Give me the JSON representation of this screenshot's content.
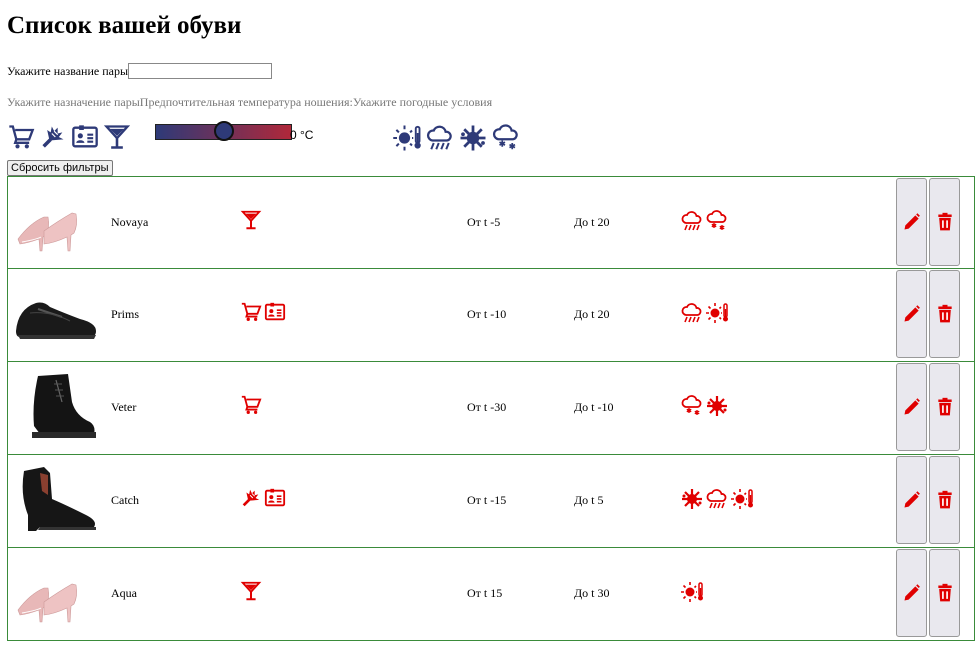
{
  "page": {
    "title": "Список вашей обуви"
  },
  "filters": {
    "name_label": "Укажите название пары",
    "name_value": "",
    "purpose_hint": "Укажите назначение пары",
    "temp_hint": "Предпочтительная температура ношения:",
    "weather_hint": "Укажите погодные условия",
    "purpose_icons": [
      "shopping-cart-icon",
      "sport-shuttlecock-icon",
      "id-card-icon",
      "cocktail-glass-icon"
    ],
    "temperature_value": "0 °C",
    "temperature_slider_fraction": 0.5,
    "weather_icons": [
      "sun-thermometer-icon",
      "rain-cloud-icon",
      "wind-splash-icon",
      "snow-cloud-icon"
    ],
    "reset_label": "Сбросить фильтры"
  },
  "colors": {
    "accent_red": "#e00000",
    "navy": "#2e3a78",
    "row_border": "#3a8b3a"
  },
  "shoes": [
    {
      "name": "Novaya",
      "from": "От t -5",
      "to": "До t 20",
      "image": "pink-pumps",
      "purpose": [
        "cocktail-glass-icon"
      ],
      "weather": [
        "rain-cloud-icon",
        "snow-cloud-icon"
      ]
    },
    {
      "name": "Prims",
      "from": "От t -10",
      "to": "До t 20",
      "image": "black-sneaker",
      "purpose": [
        "shopping-cart-icon",
        "id-card-icon"
      ],
      "weather": [
        "rain-cloud-icon",
        "sun-thermometer-icon"
      ]
    },
    {
      "name": "Veter",
      "from": "От t -30",
      "to": "До t -10",
      "image": "black-boot",
      "purpose": [
        "shopping-cart-icon"
      ],
      "weather": [
        "snow-cloud-icon",
        "wind-splash-icon"
      ]
    },
    {
      "name": "Catch",
      "from": "От t -15",
      "to": "До t 5",
      "image": "black-ankle-boot",
      "purpose": [
        "sport-shuttlecock-icon",
        "id-card-icon"
      ],
      "weather": [
        "wind-splash-icon",
        "rain-cloud-icon",
        "sun-thermometer-icon"
      ]
    },
    {
      "name": "Aqua",
      "from": "От t 15",
      "to": "До t 30",
      "image": "pink-pumps",
      "purpose": [
        "cocktail-glass-icon"
      ],
      "weather": [
        "sun-thermometer-icon"
      ]
    }
  ]
}
